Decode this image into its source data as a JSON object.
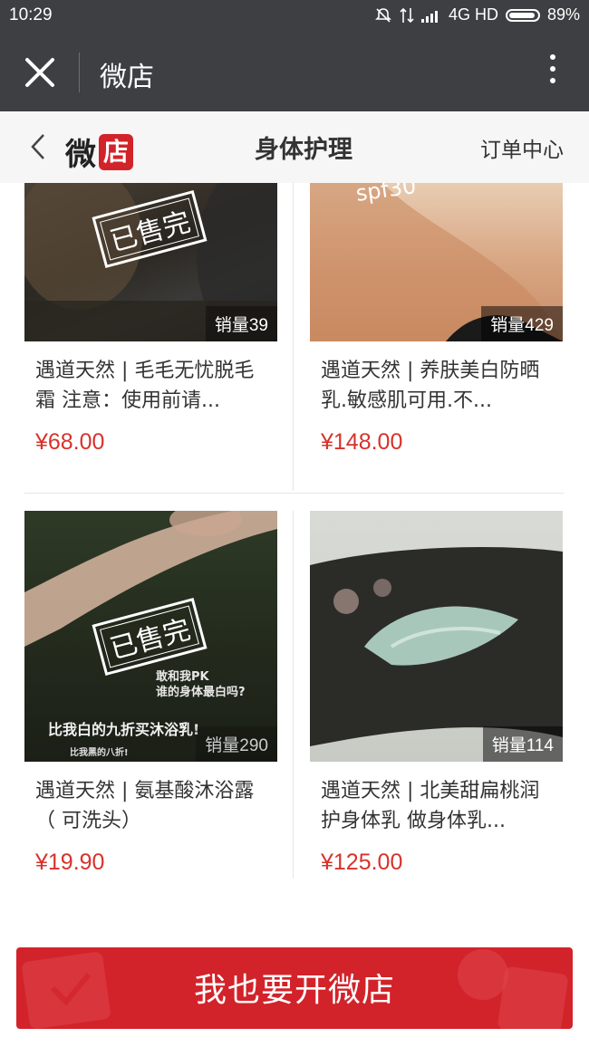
{
  "status_bar": {
    "time": "10:29",
    "network": "4G HD",
    "battery": "89%"
  },
  "app_bar": {
    "title": "微店"
  },
  "nav": {
    "logo_wei": "微",
    "logo_dian": "店",
    "title": "身体护理",
    "orders": "订单中心"
  },
  "products": [
    {
      "name": "遇道天然 | 毛毛无忧脱毛霜 注意：使用前请...",
      "price": "¥68.00",
      "sales": "销量39",
      "sold_out": true,
      "sold_out_label": "已售完"
    },
    {
      "name": "遇道天然 | 养肤美白防晒乳.敏感肌可用.不...",
      "price": "¥148.00",
      "sales": "销量429",
      "sold_out": false
    },
    {
      "name": "遇道天然 | 氨基酸沐浴露（ 可洗头）",
      "price": "¥19.90",
      "sales": "销量290",
      "sold_out": true,
      "sold_out_label": "已售完",
      "overlay_lines": [
        "敢和我PK",
        "谁的身体最白吗?",
        "比我白的九折买沐浴乳!",
        "比我黑的八折!"
      ]
    },
    {
      "name": "遇道天然 | 北美甜扁桃润护身体乳 做身体乳...",
      "price": "¥125.00",
      "sales": "销量114",
      "sold_out": false
    }
  ],
  "product2_image_text": "spf30",
  "cta": {
    "label": "我也要开微店"
  },
  "colors": {
    "brand_red": "#d2232a",
    "price_red": "#d7322b",
    "dark_bar": "#3d3f42"
  }
}
